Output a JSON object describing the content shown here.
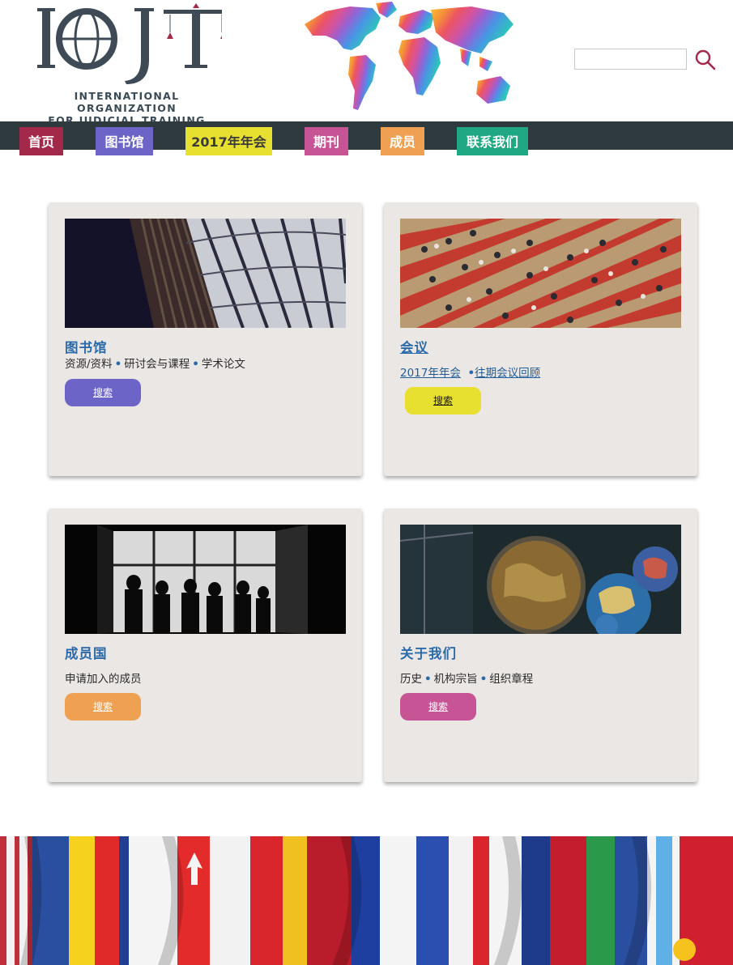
{
  "header": {
    "logo_mark": "IOJT",
    "logo_line1": "INTERNATIONAL ORGANIZATION",
    "logo_line2": "FOR JUDICIAL TRAINING",
    "search_value": ""
  },
  "nav": [
    {
      "label": "首页",
      "color": "#a3294a"
    },
    {
      "label": "图书馆",
      "color": "#6c64c6"
    },
    {
      "label": "2017年年会",
      "color": "#e8e030"
    },
    {
      "label": "期刊",
      "color": "#c75596"
    },
    {
      "label": "成员",
      "color": "#efa052"
    },
    {
      "label": "联系我们",
      "color": "#1fa882"
    }
  ],
  "cards": {
    "library": {
      "title": "图书馆",
      "items": [
        "资源/资料",
        "研讨会与课程",
        "学术论文"
      ],
      "button": "搜索",
      "button_color": "#6c64c6"
    },
    "conference": {
      "title": "会议",
      "links": [
        "2017年年会",
        "往期会议回顾"
      ],
      "button": "搜索",
      "button_color": "#e8e030"
    },
    "members": {
      "title": "成员国",
      "text": "申请加入的成员",
      "button": "搜索",
      "button_color": "#efa052"
    },
    "about": {
      "title": "关于我们",
      "items": [
        "历史",
        "机构宗旨",
        "组织章程"
      ],
      "button": "搜索",
      "button_color": "#c75596"
    }
  },
  "icons": {
    "search": "search-icon",
    "map": "world-map-graphic",
    "flags": "flags-banner"
  }
}
